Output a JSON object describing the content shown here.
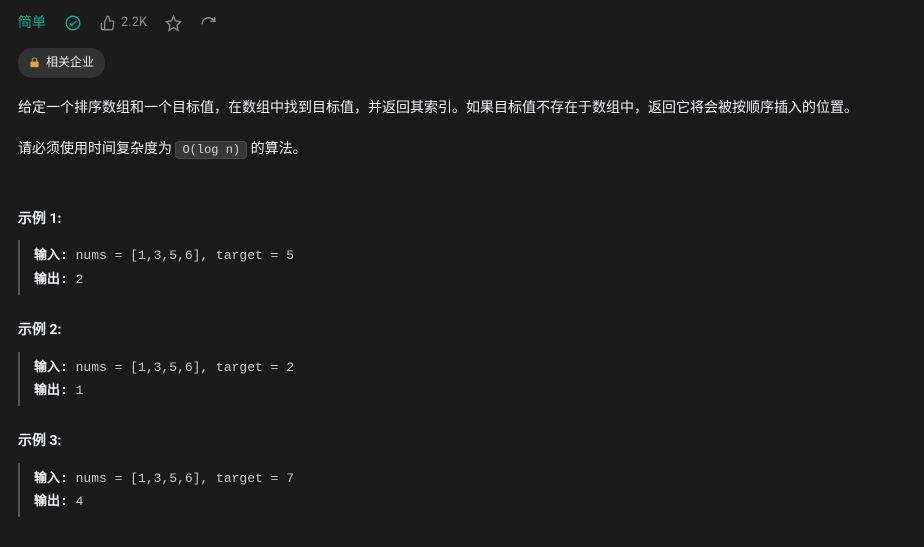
{
  "header": {
    "difficulty": "简单",
    "like_count": "2.2K"
  },
  "tag": {
    "label": "相关企业"
  },
  "description": {
    "line1": "给定一个排序数组和一个目标值，在数组中找到目标值，并返回其索引。如果目标值不存在于数组中，返回它将会被按顺序插入的位置。",
    "line2_pre": "请必须使用时间复杂度为 ",
    "line2_code": "O(log n)",
    "line2_post": " 的算法。"
  },
  "examples": [
    {
      "title": "示例 1:",
      "input_label": "输入: ",
      "input_value": "nums = [1,3,5,6], target = 5",
      "output_label": "输出: ",
      "output_value": "2"
    },
    {
      "title": "示例 2:",
      "input_label": "输入: ",
      "input_value": "nums = [1,3,5,6], target = 2",
      "output_label": "输出: ",
      "output_value": "1"
    },
    {
      "title": "示例 3:",
      "input_label": "输入: ",
      "input_value": "nums = [1,3,5,6], target = 7",
      "output_label": "输出: ",
      "output_value": "4"
    }
  ]
}
